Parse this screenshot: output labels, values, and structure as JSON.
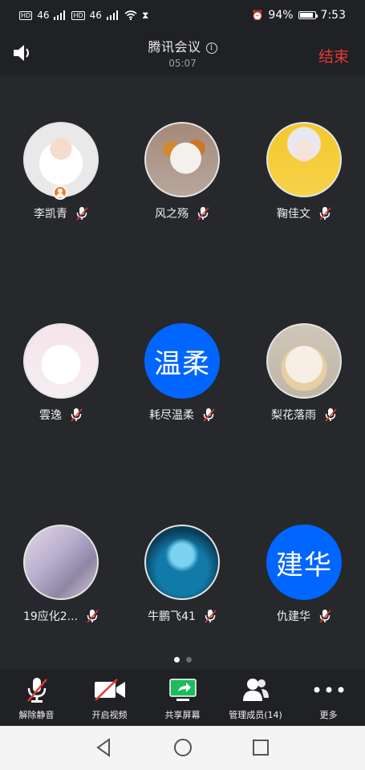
{
  "status": {
    "battery_pct": "94%",
    "battery_level": 0.94,
    "time": "7:53",
    "signal_label_1": "HD",
    "signal_label_2": "HD",
    "net_1": "46",
    "net_2": "46"
  },
  "header": {
    "title": "腾讯会议",
    "timer": "05:07",
    "end_label": "结束"
  },
  "participants": [
    {
      "name": "李凯青",
      "avatar_text": "",
      "host": true
    },
    {
      "name": "风之殇",
      "avatar_text": ""
    },
    {
      "name": "鞠佳文",
      "avatar_text": ""
    },
    {
      "name": "雲逸",
      "avatar_text": ""
    },
    {
      "name": "耗尽温柔",
      "avatar_text": "温柔"
    },
    {
      "name": "梨花落雨",
      "avatar_text": ""
    },
    {
      "name": "19应化2...",
      "avatar_text": ""
    },
    {
      "name": "牛鹏飞41",
      "avatar_text": ""
    },
    {
      "name": "仇建华",
      "avatar_text": "建华"
    }
  ],
  "pager": {
    "pages": 2,
    "current": 1
  },
  "toolbar": {
    "unmute": "解除静音",
    "video": "开启视频",
    "share": "共享屏幕",
    "members": "管理成员(14)",
    "more": "更多"
  },
  "colors": {
    "accent_blue": "#0066ff",
    "end_red": "#e53935",
    "share_green": "#1cbc5c",
    "host_orange": "#ef7a2b"
  }
}
